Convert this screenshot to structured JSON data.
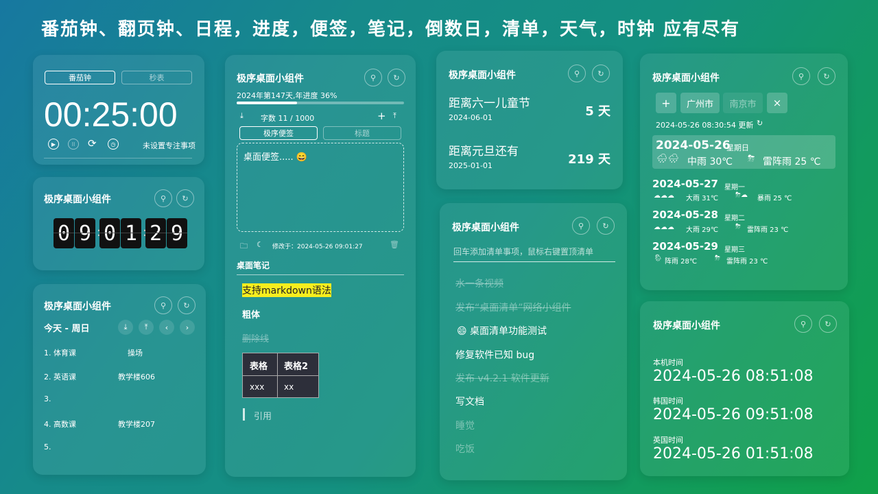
{
  "headline": "番茄钟、翻页钟、日程，进度，便签，笔记，倒数日，清单，天气，时钟 应有尽有",
  "widget_title": "极序桌面小组件",
  "pomodoro": {
    "tab_active": "番茄钟",
    "tab_other": "秒表",
    "time": "00:25:00",
    "focus": "未设置专注事项"
  },
  "flipclock": {
    "digits": [
      "0",
      "9",
      "0",
      "1",
      "2",
      "9"
    ]
  },
  "schedule": {
    "day": "今天 - 周日",
    "rows": [
      [
        "1. 体育课",
        "操场"
      ],
      [
        "2. 英语课",
        "教学楼606"
      ],
      [
        "3.",
        ""
      ],
      [
        "4. 高数课",
        "教学楼207"
      ],
      [
        "5.",
        ""
      ]
    ]
  },
  "note": {
    "progress": "2024年第147天,年进度 36%",
    "progress_pct": 36,
    "wordcount": "字数 11 / 1000",
    "tab_active": "极序便签",
    "tab_other": "标题",
    "text": "桌面便签.....",
    "modified": "修改于：2024-05-26 09:01:27",
    "md_title": "桌面笔记",
    "md_highlight": "支持markdown语法",
    "md_bold": "粗体",
    "md_strike": "删除线",
    "table": {
      "headers": [
        "表格",
        "表格2"
      ],
      "row": [
        "xxx",
        "xx"
      ]
    },
    "quote": "引用"
  },
  "countdown": [
    {
      "label": "距离六一儿童节",
      "date": "2024-06-01",
      "days": "5 天"
    },
    {
      "label": "距离元旦还有",
      "date": "2025-01-01",
      "days": "219 天"
    }
  ],
  "todo": {
    "placeholder": "回车添加清单事项，鼠标右键置顶清单",
    "items": [
      {
        "t": "水一条视频",
        "done": true
      },
      {
        "t": "发布“桌面清单”网络小组件",
        "done": true
      },
      {
        "t": "😄 桌面清单功能测试",
        "done": false
      },
      {
        "t": "修复软件已知 bug",
        "done": false
      },
      {
        "t": "发布 v4.2.1 软件更新",
        "done": true
      },
      {
        "t": "写文档",
        "done": false
      },
      {
        "t": "睡觉",
        "done": true
      },
      {
        "t": "吃饭",
        "done": true
      }
    ]
  },
  "weather": {
    "add": "+",
    "city_active": "广州市",
    "city_other": "南京市",
    "close": "×",
    "updated": "2024-05-26 08:30:54 更新",
    "today": {
      "date": "2024-05-26",
      "week": "星期日",
      "day": "中雨 30℃",
      "night": "雷阵雨 25 ℃"
    },
    "days": [
      {
        "date": "2024-05-27",
        "week": "星期一",
        "day": "大雨 31℃",
        "night": "暴雨 25 ℃"
      },
      {
        "date": "2024-05-28",
        "week": "星期二",
        "day": "大雨 29℃",
        "night": "雷阵雨 23 ℃"
      },
      {
        "date": "2024-05-29",
        "week": "星期三",
        "day": "阵雨 28℃",
        "night": "雷阵雨 23 ℃"
      }
    ]
  },
  "clock": {
    "rows": [
      {
        "label": "本机时间",
        "time": "2024-05-26 08:51:08"
      },
      {
        "label": "韩国时间",
        "time": "2024-05-26 09:51:08"
      },
      {
        "label": "英国时间",
        "time": "2024-05-26 01:51:08"
      }
    ]
  }
}
